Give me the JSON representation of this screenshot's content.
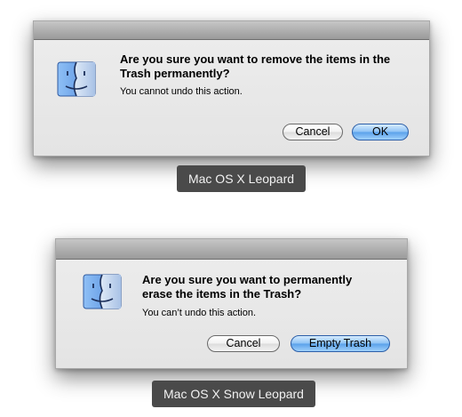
{
  "leopard": {
    "title_line1": "Are you sure you want to remove the items in the",
    "title_line2": "Trash permanently?",
    "subtext": "You cannot undo this action.",
    "cancel_label": "Cancel",
    "ok_label": "OK",
    "caption": "Mac OS X Leopard",
    "icon": "finder-icon"
  },
  "snow_leopard": {
    "title_line1": "Are you sure you want to permanently",
    "title_line2": "erase the items in the Trash?",
    "subtext": "You can’t undo this action.",
    "cancel_label": "Cancel",
    "empty_label": "Empty Trash",
    "caption": "Mac OS X Snow Leopard",
    "icon": "finder-icon"
  },
  "colors": {
    "default_button": "#6aaef0",
    "caption_bg": "#4a4a4a"
  }
}
